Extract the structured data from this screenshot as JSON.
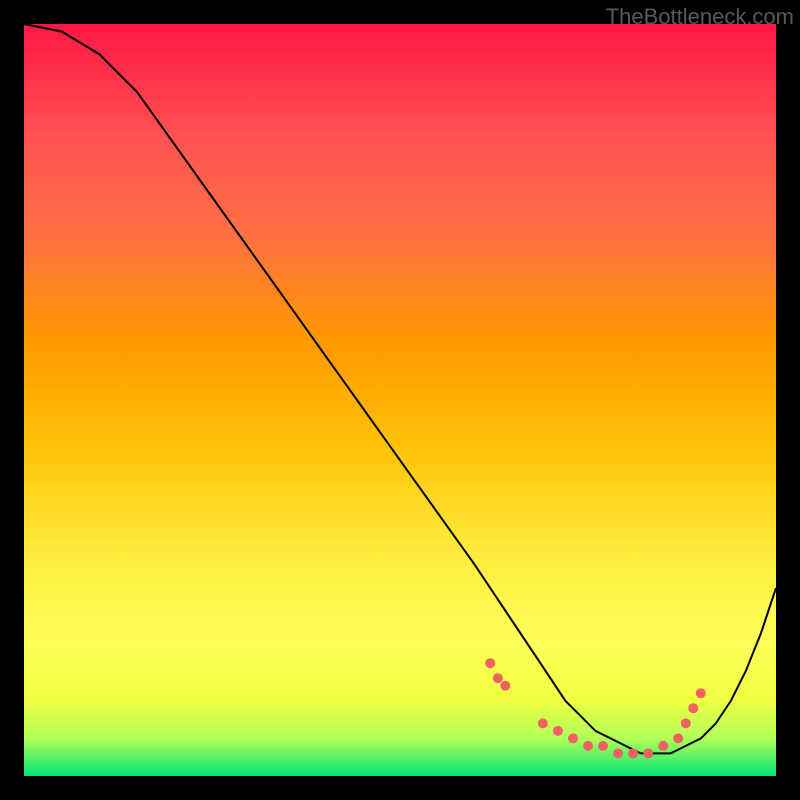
{
  "watermark": "TheBottleneck.com",
  "chart_data": {
    "type": "line",
    "title": "",
    "xlabel": "",
    "ylabel": "",
    "xlim": [
      0,
      100
    ],
    "ylim": [
      0,
      100
    ],
    "grid": false,
    "series": [
      {
        "name": "curve",
        "x": [
          0,
          5,
          10,
          15,
          20,
          25,
          30,
          35,
          40,
          45,
          50,
          55,
          60,
          62,
          64,
          66,
          68,
          70,
          72,
          74,
          76,
          78,
          80,
          82,
          84,
          86,
          88,
          90,
          92,
          94,
          96,
          98,
          100
        ],
        "y": [
          100,
          99,
          96,
          91,
          84,
          77,
          70,
          63,
          56,
          49,
          42,
          35,
          28,
          25,
          22,
          19,
          16,
          13,
          10,
          8,
          6,
          5,
          4,
          3,
          3,
          3,
          4,
          5,
          7,
          10,
          14,
          19,
          25
        ]
      }
    ],
    "markers": [
      {
        "x": 62,
        "y": 15
      },
      {
        "x": 63,
        "y": 13
      },
      {
        "x": 64,
        "y": 12
      },
      {
        "x": 69,
        "y": 7
      },
      {
        "x": 71,
        "y": 6
      },
      {
        "x": 73,
        "y": 5
      },
      {
        "x": 75,
        "y": 4
      },
      {
        "x": 77,
        "y": 4
      },
      {
        "x": 79,
        "y": 3
      },
      {
        "x": 81,
        "y": 3
      },
      {
        "x": 83,
        "y": 3
      },
      {
        "x": 85,
        "y": 4
      },
      {
        "x": 87,
        "y": 5
      },
      {
        "x": 88,
        "y": 7
      },
      {
        "x": 89,
        "y": 9
      },
      {
        "x": 90,
        "y": 11
      }
    ],
    "colors": {
      "gradient_top": "#ff1744",
      "gradient_bottom": "#00e676",
      "curve": "#000000",
      "markers": "#f06262"
    }
  }
}
